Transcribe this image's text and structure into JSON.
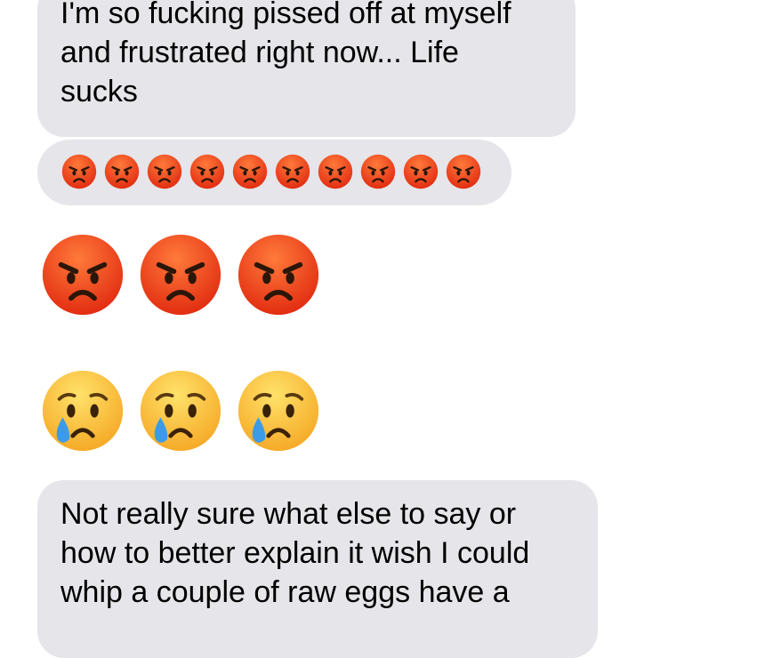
{
  "messages": [
    {
      "lines": [
        "I'm so fucking pissed off at myself",
        "and frustrated right now... Life",
        "sucks"
      ]
    },
    {
      "emoji": "angry-face-emoji",
      "count": 10
    },
    {
      "emoji": "angry-face-emoji",
      "count": 3
    },
    {
      "emoji": "crying-face-emoji",
      "count": 3
    },
    {
      "lines": [
        "Not really sure what else to say or",
        "how to better explain it wish I could",
        "whip a couple of raw eggs have a"
      ]
    }
  ],
  "colors": {
    "bubble": "#e5e5ea",
    "angry_top": "#ff7a3a",
    "angry_bottom": "#e0280f",
    "cry_top": "#ffe26a",
    "cry_bottom": "#f5a623",
    "tear": "#3b9be8"
  }
}
